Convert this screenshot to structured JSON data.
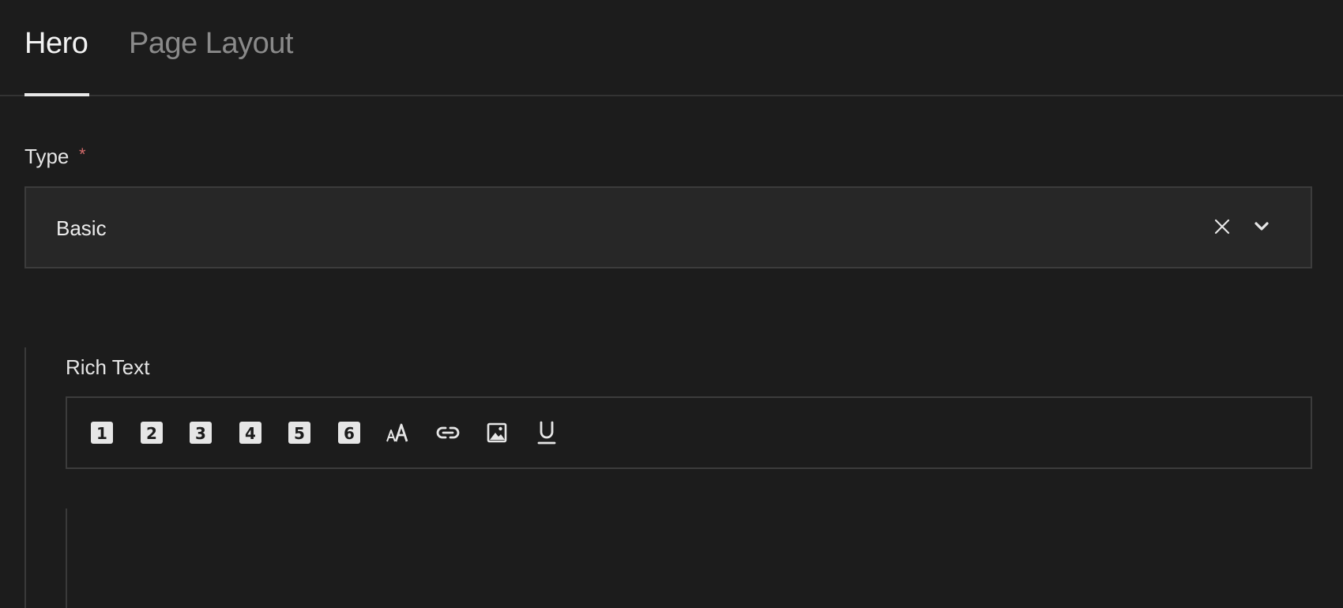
{
  "tabs": [
    {
      "label": "Hero",
      "active": true
    },
    {
      "label": "Page Layout",
      "active": false
    }
  ],
  "type_field": {
    "label": "Type",
    "required_mark": "*",
    "value": "Basic",
    "clear_icon": "close-icon",
    "dropdown_icon": "chevron-down-icon"
  },
  "rich_text": {
    "label": "Rich Text",
    "toolbar": [
      {
        "name": "heading-1",
        "icon": "heading-1-icon",
        "glyph": "1"
      },
      {
        "name": "heading-2",
        "icon": "heading-2-icon",
        "glyph": "2"
      },
      {
        "name": "heading-3",
        "icon": "heading-3-icon",
        "glyph": "3"
      },
      {
        "name": "heading-4",
        "icon": "heading-4-icon",
        "glyph": "4"
      },
      {
        "name": "heading-5",
        "icon": "heading-5-icon",
        "glyph": "5"
      },
      {
        "name": "heading-6",
        "icon": "heading-6-icon",
        "glyph": "6"
      },
      {
        "name": "font-size",
        "icon": "font-size-icon"
      },
      {
        "name": "link",
        "icon": "link-icon"
      },
      {
        "name": "image",
        "icon": "image-icon"
      },
      {
        "name": "underline",
        "icon": "underline-icon"
      }
    ]
  },
  "colors": {
    "background": "#1c1c1c",
    "active_tab": "#f2f2f2",
    "inactive_tab": "#8a8a8a",
    "required": "#d26a6a",
    "border": "#3c3c3c"
  }
}
